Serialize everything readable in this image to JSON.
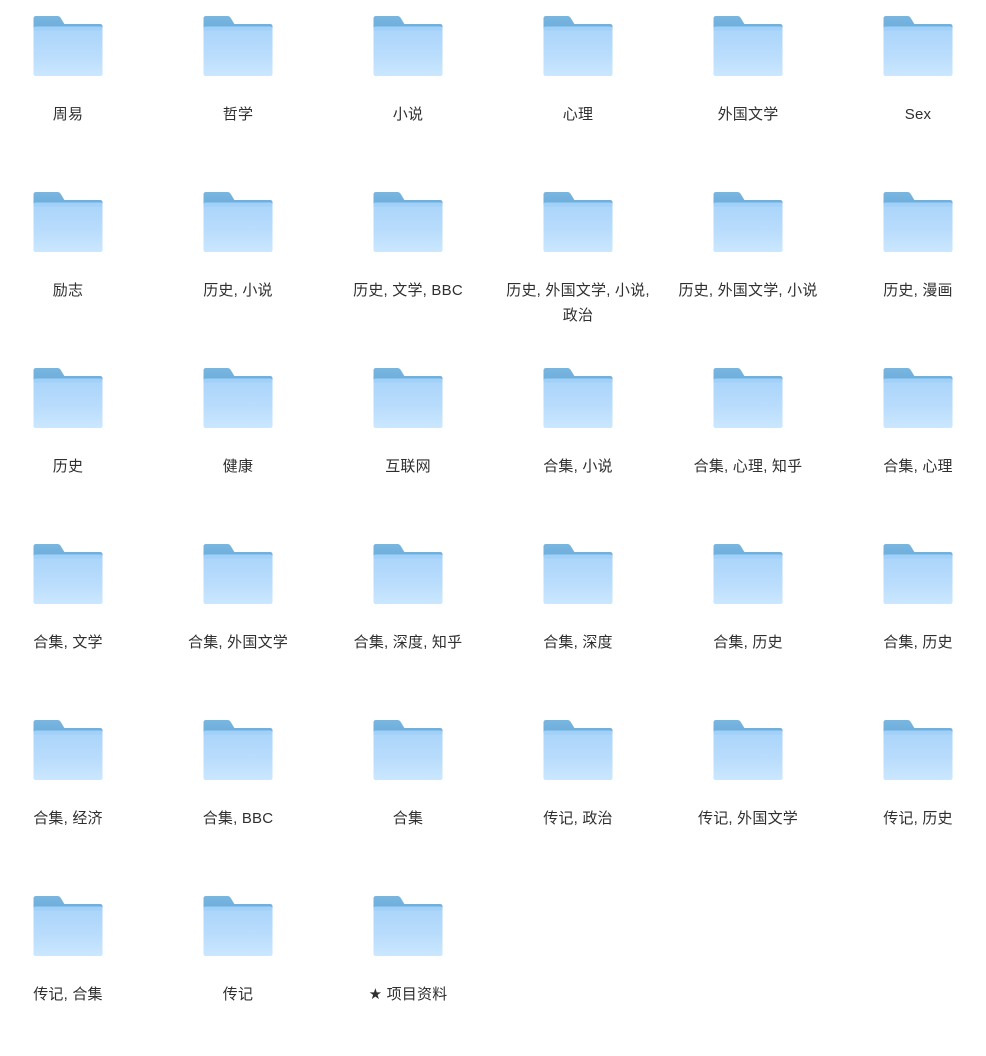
{
  "view": {
    "type": "folder-grid",
    "columns": 6,
    "rows": 6,
    "background_color": "#ffffff",
    "label_color": "#2f2f2f",
    "folder_tab_color": "#6EB1DE",
    "folder_body_top_color": "#AFD8FB",
    "folder_body_bottom_color": "#C6E3FD"
  },
  "folders": [
    [
      {
        "label": "周易",
        "icon": "folder-icon"
      },
      {
        "label": "哲学",
        "icon": "folder-icon"
      },
      {
        "label": "小说",
        "icon": "folder-icon"
      },
      {
        "label": "心理",
        "icon": "folder-icon"
      },
      {
        "label": "外国文学",
        "icon": "folder-icon"
      },
      {
        "label": "Sex",
        "icon": "folder-icon"
      }
    ],
    [
      {
        "label": "励志",
        "icon": "folder-icon"
      },
      {
        "label": "历史, 小说",
        "icon": "folder-icon"
      },
      {
        "label": "历史, 文学, BBC",
        "icon": "folder-icon"
      },
      {
        "label": "历史, 外国文学, 小说, 政治",
        "icon": "folder-icon"
      },
      {
        "label": "历史, 外国文学, 小说",
        "icon": "folder-icon"
      },
      {
        "label": "历史, 漫画",
        "icon": "folder-icon"
      }
    ],
    [
      {
        "label": "历史",
        "icon": "folder-icon"
      },
      {
        "label": "健康",
        "icon": "folder-icon"
      },
      {
        "label": "互联网",
        "icon": "folder-icon"
      },
      {
        "label": "合集, 小说",
        "icon": "folder-icon"
      },
      {
        "label": "合集, 心理, 知乎",
        "icon": "folder-icon"
      },
      {
        "label": "合集, 心理",
        "icon": "folder-icon"
      }
    ],
    [
      {
        "label": "合集, 文学",
        "icon": "folder-icon"
      },
      {
        "label": "合集, 外国文学",
        "icon": "folder-icon"
      },
      {
        "label": "合集, 深度, 知乎",
        "icon": "folder-icon"
      },
      {
        "label": "合集, 深度",
        "icon": "folder-icon"
      },
      {
        "label": "合集, 历史",
        "icon": "folder-icon"
      },
      {
        "label": "合集, 历史",
        "icon": "folder-icon"
      }
    ],
    [
      {
        "label": "合集, 经济",
        "icon": "folder-icon"
      },
      {
        "label": "合集, BBC",
        "icon": "folder-icon"
      },
      {
        "label": "合集",
        "icon": "folder-icon"
      },
      {
        "label": "传记, 政治",
        "icon": "folder-icon"
      },
      {
        "label": "传记, 外国文学",
        "icon": "folder-icon"
      },
      {
        "label": "传记, 历史",
        "icon": "folder-icon"
      }
    ],
    [
      {
        "label": "传记, 合集",
        "icon": "folder-icon"
      },
      {
        "label": "传记",
        "icon": "folder-icon"
      },
      {
        "label": "★ 项目资料",
        "icon": "folder-icon"
      }
    ]
  ]
}
